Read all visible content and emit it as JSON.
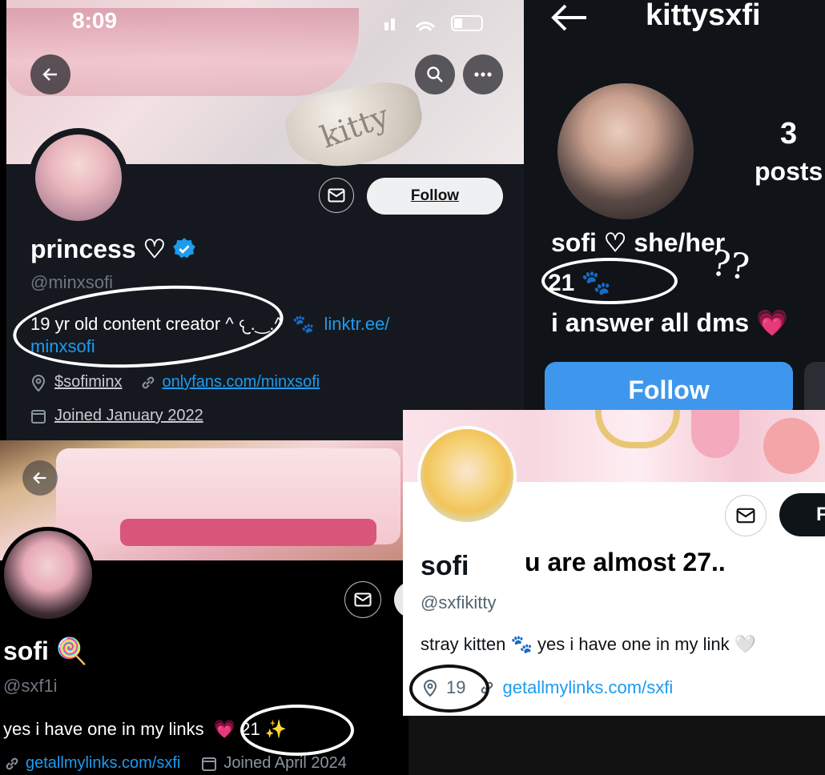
{
  "p1": {
    "status_time": "8:09",
    "banner_text": "kitty",
    "name": "princess ♡",
    "handle": "@minxsofi",
    "bio_text": "19 yr old content creator ^ 𐔌.‿.^",
    "bio_link": "linktr.ee/minxsofi",
    "bio_link_line1": "linktr.ee/",
    "bio_link_line2": "minxsofi",
    "location": "$sofiminx",
    "website": "onlyfans.com/minxsofi",
    "joined": "Joined January 2022",
    "follow_label": "Follow"
  },
  "p2": {
    "title": "kittysxfi",
    "posts_count": "3",
    "posts_label": "posts",
    "name_line": "sofi ♡ she/her",
    "age_line": "21 🐾",
    "note": "??",
    "bio": "i answer all dms 💗",
    "follow_label": "Follow"
  },
  "p3": {
    "name": "sofi 🍭",
    "handle": "@sxf1i",
    "bio": "yes i have one in my links 💗 21 ✨",
    "bio_part1": "yes i have one in my links",
    "bio_part2": "💗 21 ✨",
    "website": "getallmylinks.com/sxfi",
    "joined": "Joined April 2024"
  },
  "p4": {
    "name": "sofi",
    "handle": "@sxfikitty",
    "bio": "stray kitten 🐾 yes i have one in my link 🤍",
    "location": "19",
    "website": "getallmylinks.com/sxfi",
    "follow_partial": "F"
  },
  "annotation": {
    "caption": "u are almost 27.."
  },
  "colors": {
    "x_dark_bg": "#14181f",
    "link_blue": "#1d9bf0",
    "follow_blue": "#3e97ec",
    "verified": "#1d9bf0"
  }
}
